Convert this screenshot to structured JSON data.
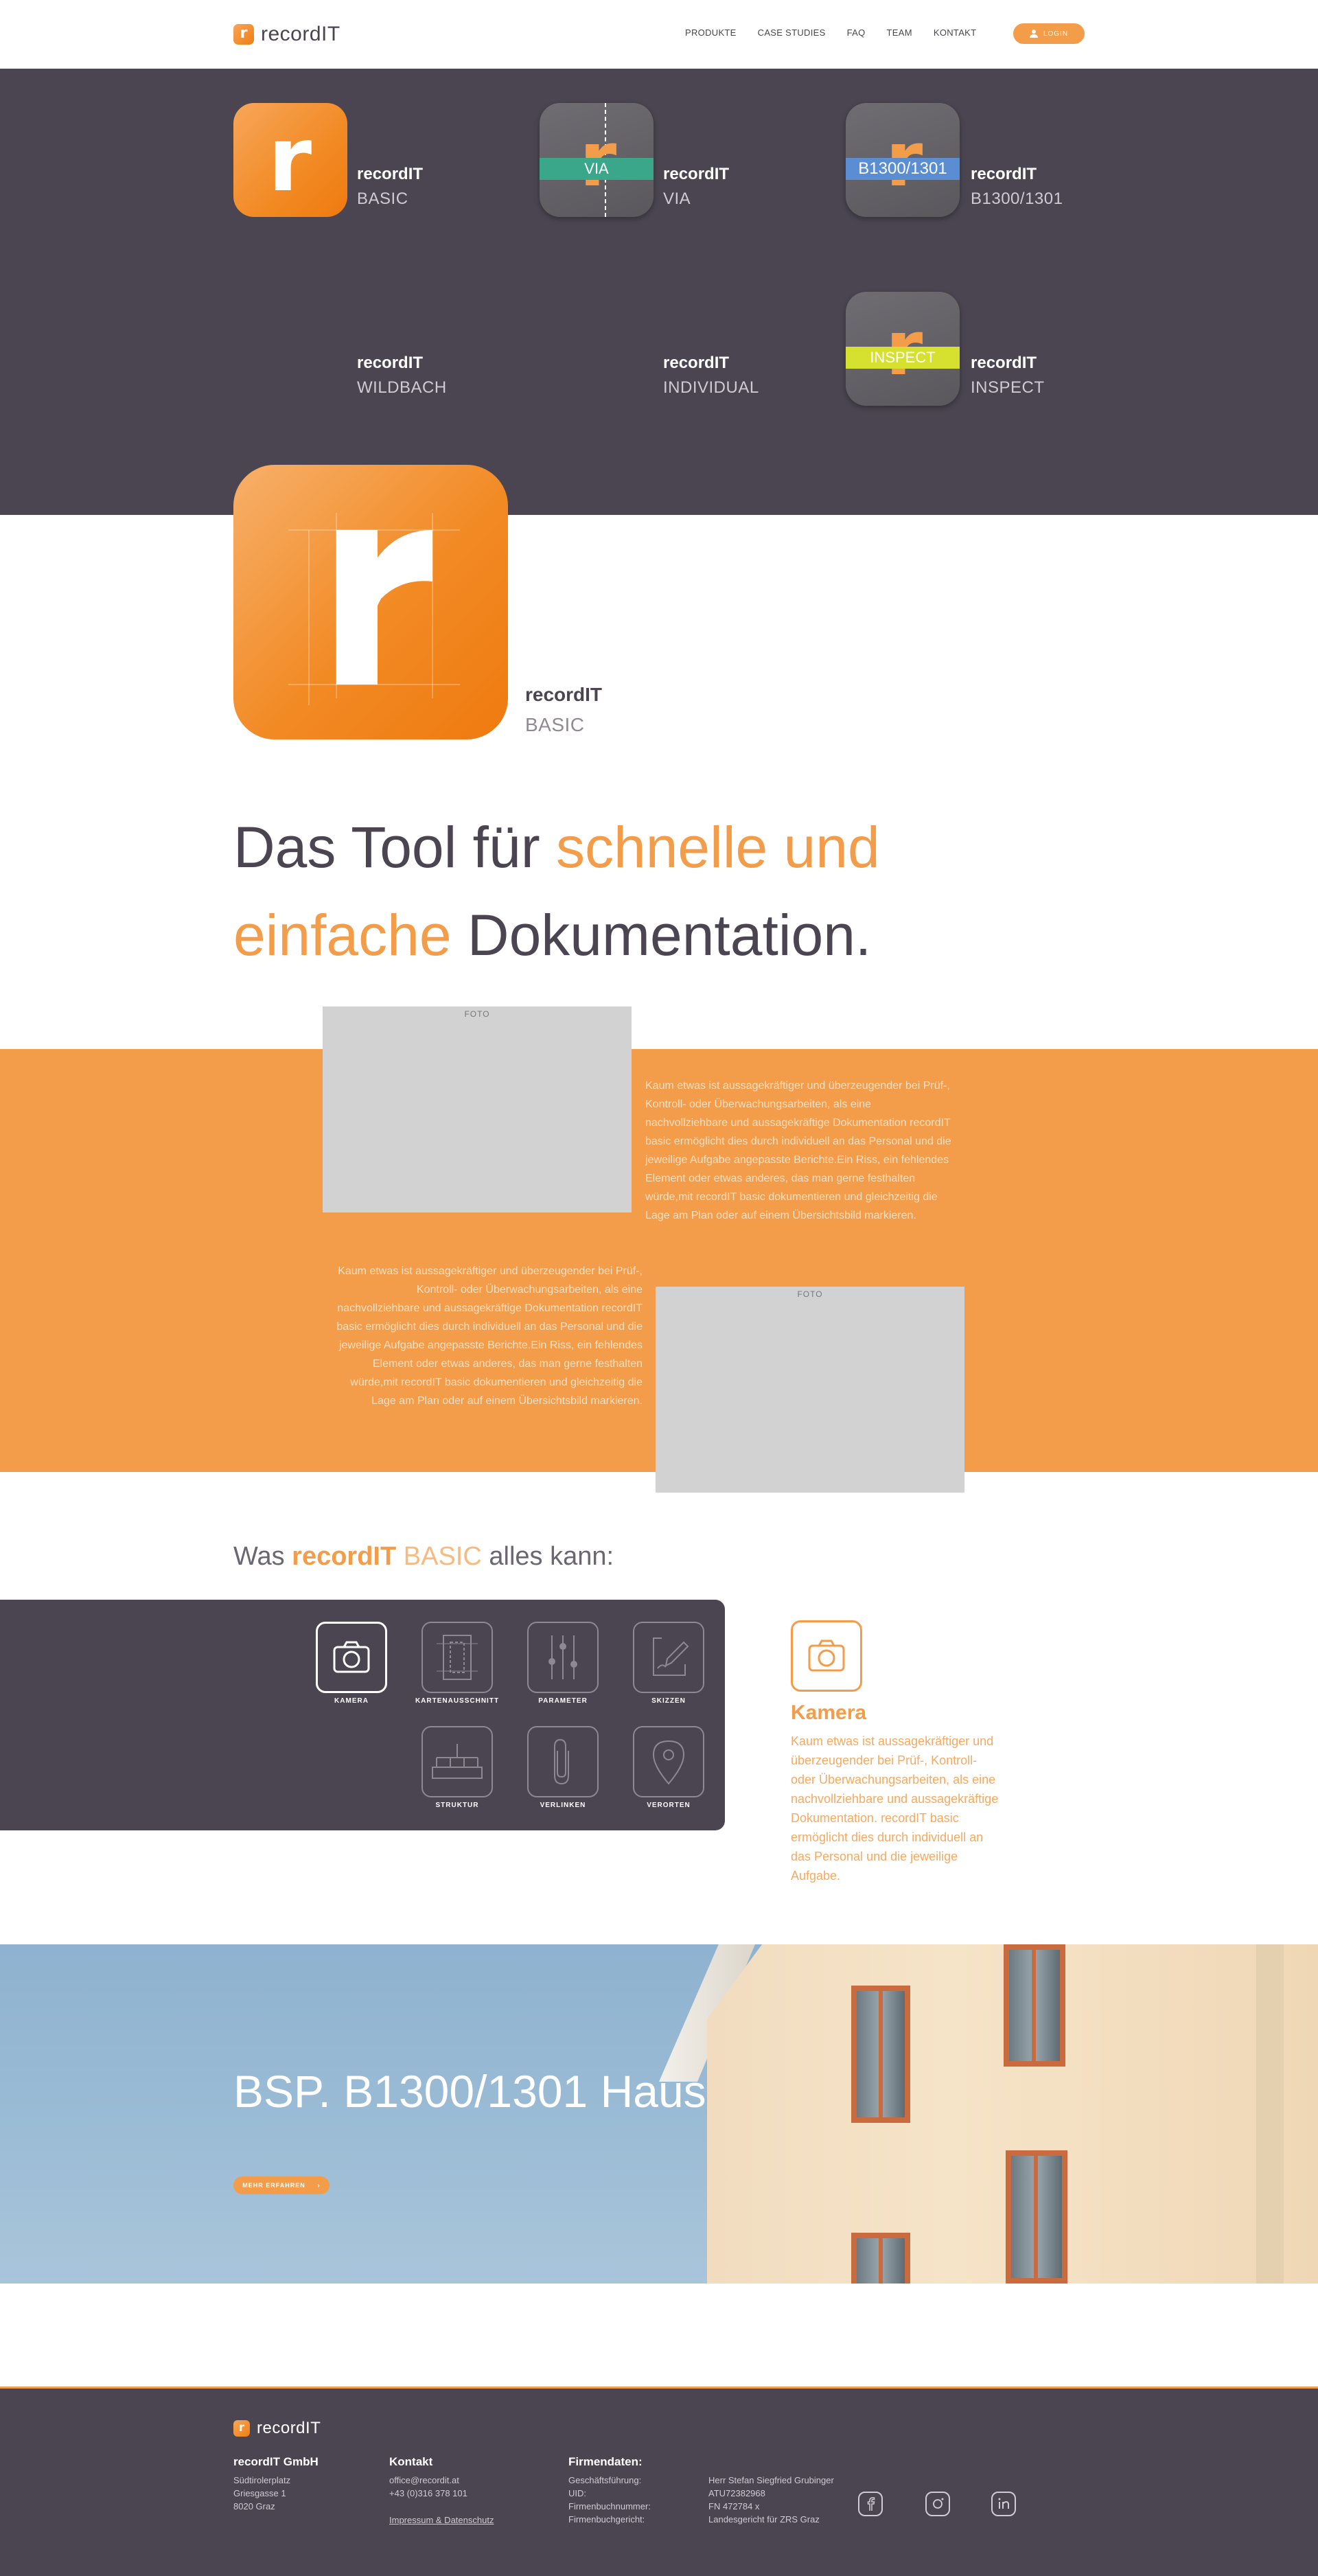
{
  "header": {
    "logo_mark": "r",
    "logo_text": "recordIT",
    "nav": [
      "PRODUKTE",
      "CASE STUDIES",
      "FAQ",
      "TEAM",
      "KONTAKT"
    ],
    "login": "LOGIN"
  },
  "products": [
    {
      "title": "recordIT",
      "sub": "BASIC",
      "badge": ""
    },
    {
      "title": "recordIT",
      "sub": "VIA",
      "badge": "VIA"
    },
    {
      "title": "recordIT",
      "sub": "B1300/1301",
      "badge": "B1300/1301"
    },
    {
      "title": "recordIT",
      "sub": "WILDBACH",
      "badge": ""
    },
    {
      "title": "recordIT",
      "sub": "INDIVIDUAL",
      "badge": ""
    },
    {
      "title": "recordIT",
      "sub": "INSPECT",
      "badge": "INSPECT"
    }
  ],
  "hero": {
    "title": "recordIT",
    "sub": "BASIC",
    "headline_1": "Das Tool für ",
    "headline_orange": "schnelle und einfache",
    "headline_2": " Dokumentation."
  },
  "orange_section": {
    "photo_label": "FOTO",
    "paragraph": "Kaum etwas ist aussagekräftiger und überzeugender bei Prüf-, Kontroll- oder Überwachungsarbeiten, als eine nachvollziehbare und aussagekräftige Dokumentation recordIT basic ermöglicht dies durch individuell an das Personal und die jeweilige Aufgabe angepasste Berichte.Ein Riss, ein fehlendes Element oder etwas anderes, das man gerne festhalten würde,mit recordIT basic dokumentieren und gleichzeitig die Lage am Plan oder auf einem Übersichtsbild markieren."
  },
  "features": {
    "heading_1": "Was ",
    "heading_brand": "recordIT",
    "heading_light": " BASIC",
    "heading_2": " alles kann:",
    "tiles": [
      "KAMERA",
      "KARTENAUSSCHNITT",
      "PARAMETER",
      "SKIZZEN",
      "STRUKTUR",
      "VERLINKEN",
      "VERORTEN"
    ],
    "detail_title": "Kamera",
    "detail_text": "Kaum etwas ist aussagekräftiger und überzeugender bei Prüf-, Kontroll- oder Überwachungsarbeiten, als eine nachvollziehbare und aussagekräftige Dokumentation. recordIT basic ermöglicht dies durch individuell an das Personal und die jeweilige Aufgabe."
  },
  "banner": {
    "title": "BSP. B1300/1301 Haus",
    "button": "MEHR ERFAHREN",
    "button_arrow": "›"
  },
  "footer": {
    "logo_text": "recordIT",
    "company_head": "recordIT GmbH",
    "company_lines": [
      "Südtirolerplatz",
      "Griesgasse 1",
      "8020 Graz"
    ],
    "contact_head": "Kontakt",
    "contact_lines": [
      "office@recordit.at",
      "+43 (0)316 378 101"
    ],
    "contact_link": "Impressum & Datenschutz",
    "firm_head": "Firmendaten:",
    "firm_labels": [
      "Geschäftsführung:",
      "UID:",
      "Firmenbuchnummer:",
      "Firmenbuchgericht:"
    ],
    "firm_values": [
      "Herr Stefan Siegfried Grubinger",
      "ATU72382968",
      "FN 472784 x",
      "Landesgericht für ZRS Graz"
    ]
  },
  "colors": {
    "accent": "#f39c49",
    "dark": "#4a4551",
    "photo": "#d2d2d2"
  }
}
